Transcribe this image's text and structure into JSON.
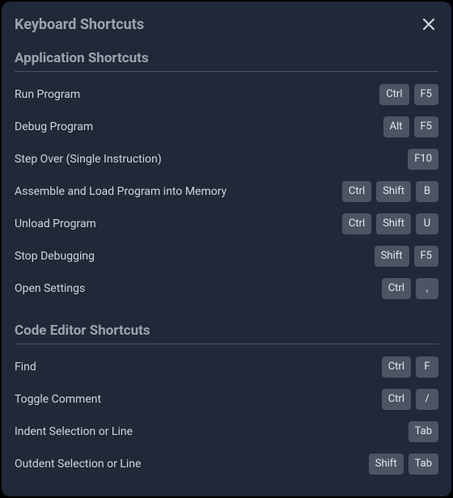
{
  "title": "Keyboard Shortcuts",
  "sections": [
    {
      "title": "Application Shortcuts",
      "rows": [
        {
          "label": "Run Program",
          "keys": [
            "Ctrl",
            "F5"
          ]
        },
        {
          "label": "Debug Program",
          "keys": [
            "Alt",
            "F5"
          ]
        },
        {
          "label": "Step Over (Single Instruction)",
          "keys": [
            "F10"
          ]
        },
        {
          "label": "Assemble and Load Program into Memory",
          "keys": [
            "Ctrl",
            "Shift",
            "B"
          ]
        },
        {
          "label": "Unload Program",
          "keys": [
            "Ctrl",
            "Shift",
            "U"
          ]
        },
        {
          "label": "Stop Debugging",
          "keys": [
            "Shift",
            "F5"
          ]
        },
        {
          "label": "Open Settings",
          "keys": [
            "Ctrl",
            ","
          ]
        }
      ]
    },
    {
      "title": "Code Editor Shortcuts",
      "rows": [
        {
          "label": "Find",
          "keys": [
            "Ctrl",
            "F"
          ]
        },
        {
          "label": "Toggle Comment",
          "keys": [
            "Ctrl",
            "/"
          ]
        },
        {
          "label": "Indent Selection or Line",
          "keys": [
            "Tab"
          ]
        },
        {
          "label": "Outdent Selection or Line",
          "keys": [
            "Shift",
            "Tab"
          ]
        }
      ]
    }
  ]
}
